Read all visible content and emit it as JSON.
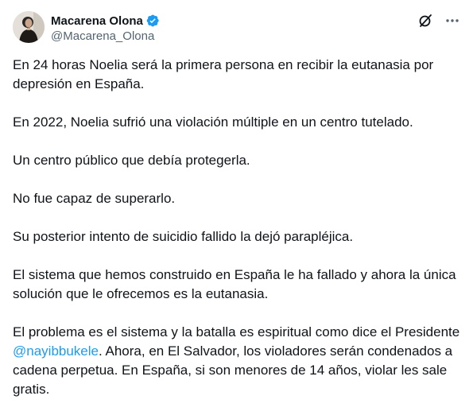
{
  "author": {
    "display_name": "Macarena Olona",
    "handle": "@Macarena_Olona",
    "verified": true
  },
  "icons": {
    "verified": "verified-badge-icon",
    "grok": "grok-icon",
    "more": "more-options-icon"
  },
  "colors": {
    "text": "#0f1419",
    "secondary": "#536471",
    "accent": "#1d9bf0"
  },
  "tweet": {
    "p1": "En 24 horas Noelia será la primera persona en recibir la eutanasia por depresión en España.",
    "p2": "En 2022, Noelia sufrió una violación múltiple en un centro tutelado.",
    "p3": "Un centro público que debía protegerla.",
    "p4": "No fue capaz de superarlo.",
    "p5": "Su posterior intento de suicidio fallido la dejó parapléjica.",
    "p6": "El sistema que hemos construido en España le ha fallado y ahora la única solución que le ofrecemos es la eutanasia.",
    "p7_before": "El problema es el sistema y la batalla es espiritual como dice el Presidente ",
    "p7_mention": "@nayibbukele",
    "p7_after": ". Ahora, en El Salvador, los violadores serán condenados a cadena perpetua. En España, si son menores de 14 años, violar les sale gratis."
  }
}
